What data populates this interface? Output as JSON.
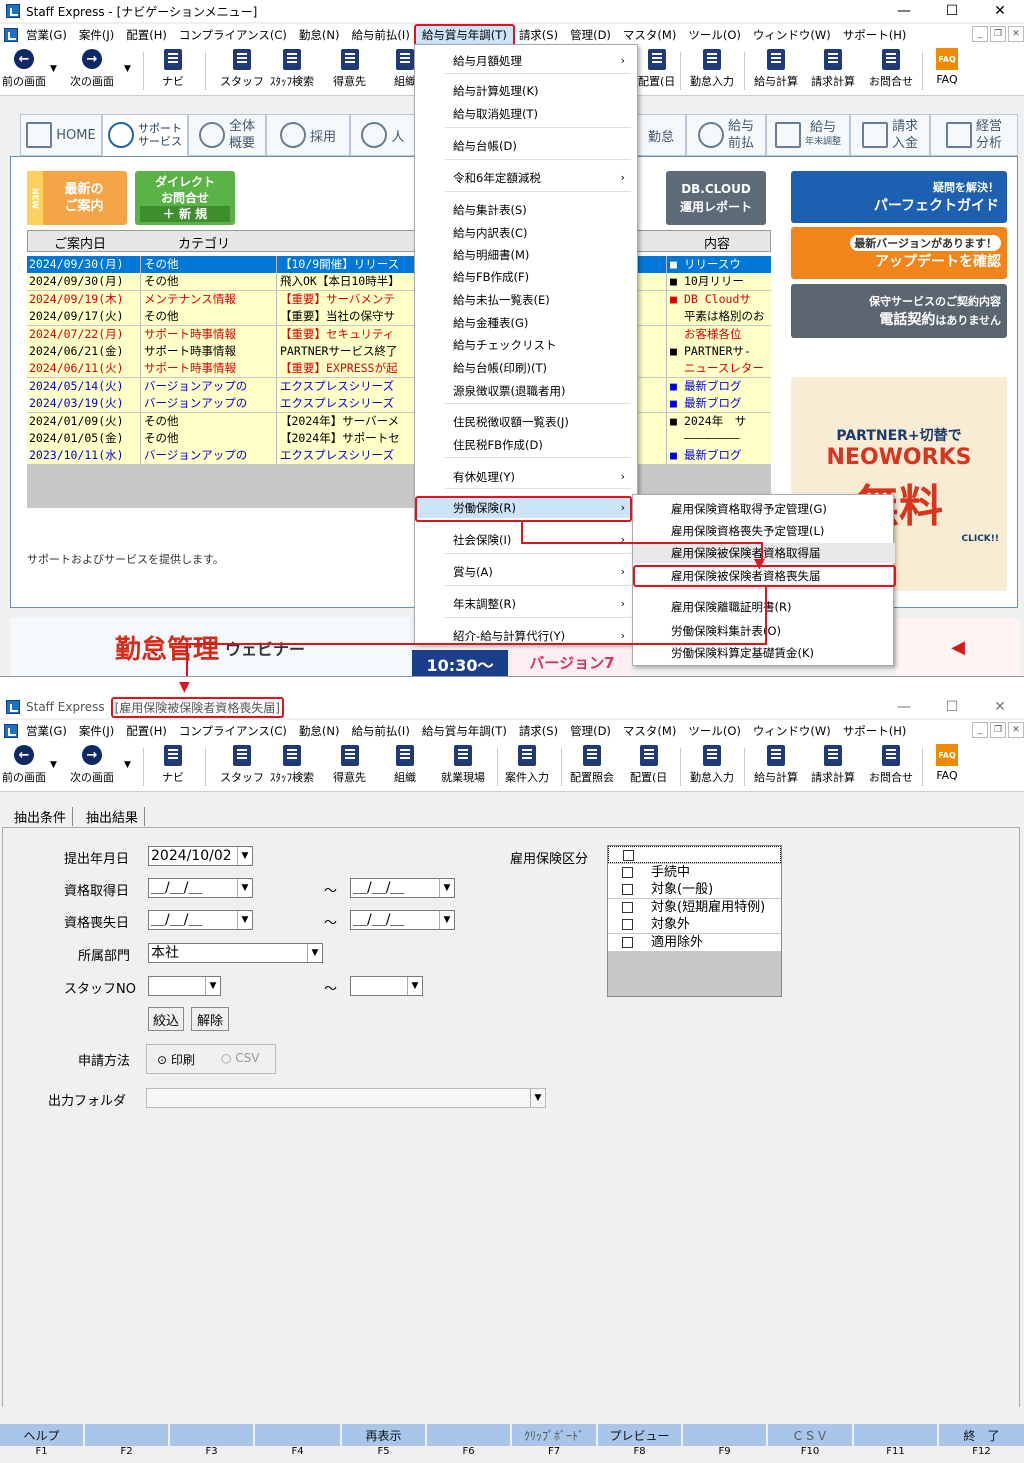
{
  "top": {
    "title": "Staff Express - [ナビゲーションメニュー]",
    "menu": [
      "営業(G)",
      "案件(J)",
      "配置(H)",
      "コンプライアンス(C)",
      "勤怠(N)",
      "給与前払(I)",
      "給与賞与年調(T)",
      "請求(S)",
      "管理(D)",
      "マスタ(M)",
      "ツール(O)",
      "ウィンドウ(W)",
      "サポート(H)"
    ],
    "toolbar": {
      "prev": "前の画面",
      "next": "次の画面",
      "navi": "ナビ",
      "staff": "スタッフ",
      "staff_search": "ｽﾀｯﾌ検索",
      "client": "得意先",
      "org": "組織",
      "haichi": "配置(日",
      "kintai": "勤怠入力",
      "kyuyo": "給与計算",
      "seikyu": "請求計算",
      "toiawase": "お問合せ",
      "faq": "FAQ"
    },
    "navtabs": {
      "home": "HOME",
      "support1": "サポート",
      "support2": "サービス",
      "zentai1": "全体",
      "zentai2": "概要",
      "saiyo": "採用",
      "jin": "人",
      "kintai": "勤怠",
      "zenbarai1": "給与",
      "zenbarai2": "前払",
      "nenmatsu1": "給与",
      "nenmatsu2": "年末調整",
      "seikyu1": "請求",
      "seikyu2": "入金",
      "keiei1": "経営",
      "keiei2": "分析"
    },
    "panel": {
      "new_info1": "最新の",
      "new_info2": "ご案内",
      "new_badge": "NEW",
      "direct1": "ダイレクト",
      "direct2": "お問合せ",
      "direct3": "＋ 新 規",
      "dbcloud1": "DB.CLOUD",
      "dbcloud2": "運用レポート",
      "col_date": "ご案内日",
      "col_cat": "カテゴリ",
      "col_content": "内容",
      "footer": "サポートおよびサービスを提供します。"
    },
    "news": [
      {
        "date": "2024/09/30(月)",
        "cat": "その他",
        "title": "【10/9開催】リリース",
        "mark": "■",
        "right": "リリースウ",
        "color": "sel"
      },
      {
        "date": "2024/09/30(月)",
        "cat": "その他",
        "title": "飛入OK【本日10時半】",
        "mark": "■",
        "right": "10月リリー",
        "color": "black"
      },
      {
        "date": "2024/09/19(木)",
        "cat": "メンテナンス情報",
        "title": "【重要】サーバメンテ",
        "mark": "■",
        "right": "DB Cloudサ",
        "color": "red"
      },
      {
        "date": "2024/09/17(火)",
        "cat": "その他",
        "title": "【重要】当社の保守サ",
        "mark": "",
        "right": "平素は格別のお",
        "color": "black"
      },
      {
        "date": "2024/07/22(月)",
        "cat": "サポート時事情報",
        "title": "【重要】セキュリティ",
        "mark": "",
        "right": "お客様各位",
        "color": "red"
      },
      {
        "date": "2024/06/21(金)",
        "cat": "サポート時事情報",
        "title": "PARTNERサービス終了",
        "mark": "■",
        "right": "PARTNERサ-",
        "color": "black"
      },
      {
        "date": "2024/06/11(火)",
        "cat": "サポート時事情報",
        "title": "【重要】EXPRESSが起",
        "mark": "",
        "right": "ニュースレター",
        "color": "red"
      },
      {
        "date": "2024/05/14(火)",
        "cat": "バージョンアップの",
        "title": "エクスプレスシリーズ",
        "mark": "■",
        "right": "最新ブログ",
        "color": "blue"
      },
      {
        "date": "2024/03/19(火)",
        "cat": "バージョンアップの",
        "title": "エクスプレスシリーズ",
        "mark": "■",
        "right": "最新ブログ",
        "color": "blue"
      },
      {
        "date": "2024/01/09(火)",
        "cat": "その他",
        "title": "【2024年】サーバーメ",
        "mark": "■",
        "right": "2024年　サ",
        "color": "black"
      },
      {
        "date": "2024/01/05(金)",
        "cat": "その他",
        "title": "【2024年】サポートセ",
        "mark": "",
        "right": "————————",
        "color": "black"
      },
      {
        "date": "2023/10/11(水)",
        "cat": "バージョンアップの",
        "title": "エクスプレスシリーズ",
        "mark": "■",
        "right": "最新ブログ",
        "color": "blue"
      }
    ],
    "banners": {
      "perfect1": "疑問を解決！",
      "perfect2": "パーフェクトガイド",
      "update1": "最新バージョンがあります！",
      "update2": "アップデートを確認",
      "hoshu1": "保守サービスのご契約内容",
      "hoshu2": "電話契約",
      "hoshu3": "はありません",
      "neo1": "PARTNER+切替で",
      "neo2": "NEOWORKS",
      "neo3": "無料",
      "click": "CLICK!!",
      "webinar1": "勤怠管理",
      "webinar2": "ウェビナー",
      "time": "10:30～",
      "version": "バージョン7"
    },
    "dropdown": [
      "給与月額処理",
      "給与計算処理(K)",
      "給与取消処理(T)",
      "給与台帳(D)",
      "令和6年定額減税",
      "給与集計表(S)",
      "給与内訳表(C)",
      "給与明細書(M)",
      "給与FB作成(F)",
      "給与未払一覧表(E)",
      "給与金種表(G)",
      "給与チェックリスト",
      "給与台帳(印刷)(T)",
      "源泉徴収票(退職者用)",
      "住民税徴収額一覧表(J)",
      "住民税FB作成(D)",
      "有休処理(Y)",
      "労働保険(R)",
      "社会保険(I)",
      "賞与(A)",
      "年末調整(R)",
      "紹介-給与計算代行(Y)"
    ],
    "submenu": [
      "雇用保険資格取得予定管理(G)",
      "雇用保険資格喪失予定管理(L)",
      "雇用保険被保険者資格取得届",
      "雇用保険被保険者資格喪失届",
      "雇用保険離職証明書(R)",
      "労働保険料集計表(O)",
      "労働保険料算定基礎賃金(K)"
    ]
  },
  "bottom": {
    "title_app": "Staff Express",
    "title_doc": "[雇用保険被保険者資格喪失届]",
    "toolbar": {
      "genba": "就業現場",
      "anken": "案件入力",
      "shokai": "配置照会"
    },
    "tabs": [
      "抽出条件",
      "抽出結果"
    ],
    "form": {
      "submit_label": "提出年月日",
      "submit_value": "2024/10/02",
      "acq_label": "資格取得日",
      "loss_label": "資格喪失日",
      "date_blank": "＿/＿/＿",
      "tilde": "～",
      "dept_label": "所属部門",
      "dept_value": "本社",
      "staff_label": "スタッフNO",
      "filter_btn": "絞込",
      "clear_btn": "解除",
      "method_label": "申請方法",
      "method_print": "印刷",
      "method_csv": "CSV",
      "folder_label": "出力フォルダ",
      "ins_label": "雇用保険区分",
      "ins_options": [
        "",
        "手続中",
        "対象(一般)",
        "対象(短期雇用特例)",
        "対象外",
        "適用除外"
      ]
    },
    "fkeys": [
      {
        "label": "ヘルプ",
        "num": "F1"
      },
      {
        "label": "",
        "num": "F2"
      },
      {
        "label": "",
        "num": "F3"
      },
      {
        "label": "",
        "num": "F4"
      },
      {
        "label": "再表示",
        "num": "F5"
      },
      {
        "label": "",
        "num": "F6"
      },
      {
        "label": "ｸﾘｯﾌﾟﾎﾞｰﾄﾞ",
        "num": "F7"
      },
      {
        "label": "プレビュー",
        "num": "F8"
      },
      {
        "label": "",
        "num": "F9"
      },
      {
        "label": "ＣＳＶ",
        "num": "F10"
      },
      {
        "label": "",
        "num": "F11"
      },
      {
        "label": "終　了",
        "num": "F12"
      }
    ]
  }
}
